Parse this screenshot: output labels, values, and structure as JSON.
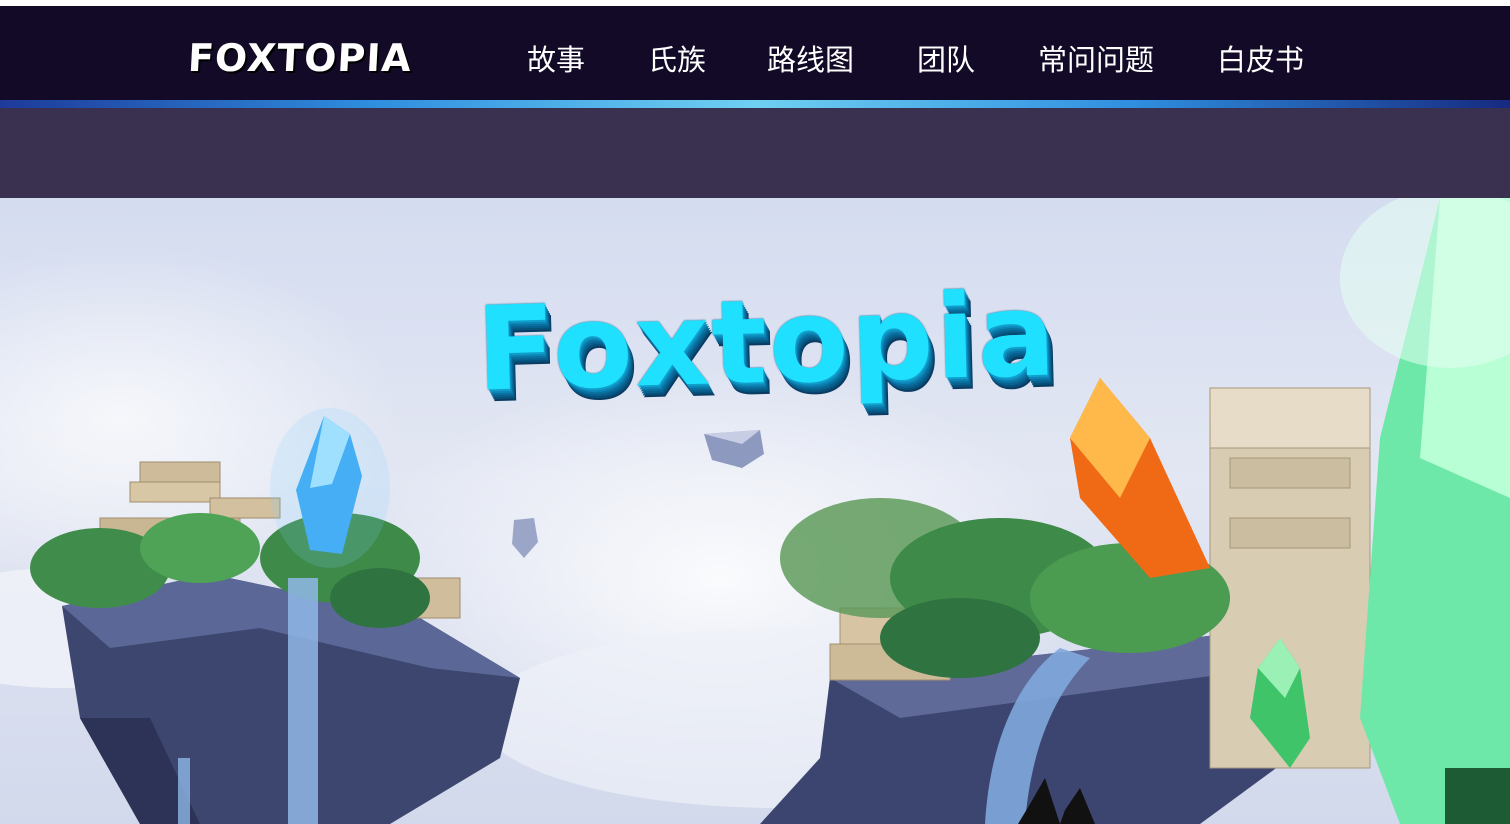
{
  "header": {
    "logo_text": "FOXTOPIA",
    "nav_items": [
      {
        "label": "故事"
      },
      {
        "label": "氏族"
      },
      {
        "label": "路线图"
      },
      {
        "label": "团队"
      },
      {
        "label": "常问问题"
      },
      {
        "label": "白皮书"
      }
    ]
  },
  "hero": {
    "title": "Foxtopia",
    "illustration_icon": "floating-islands-illustration"
  },
  "colors": {
    "nav_background": "#120a26",
    "subbar_background": "#3a3151",
    "title_color": "#1fe1ff"
  }
}
